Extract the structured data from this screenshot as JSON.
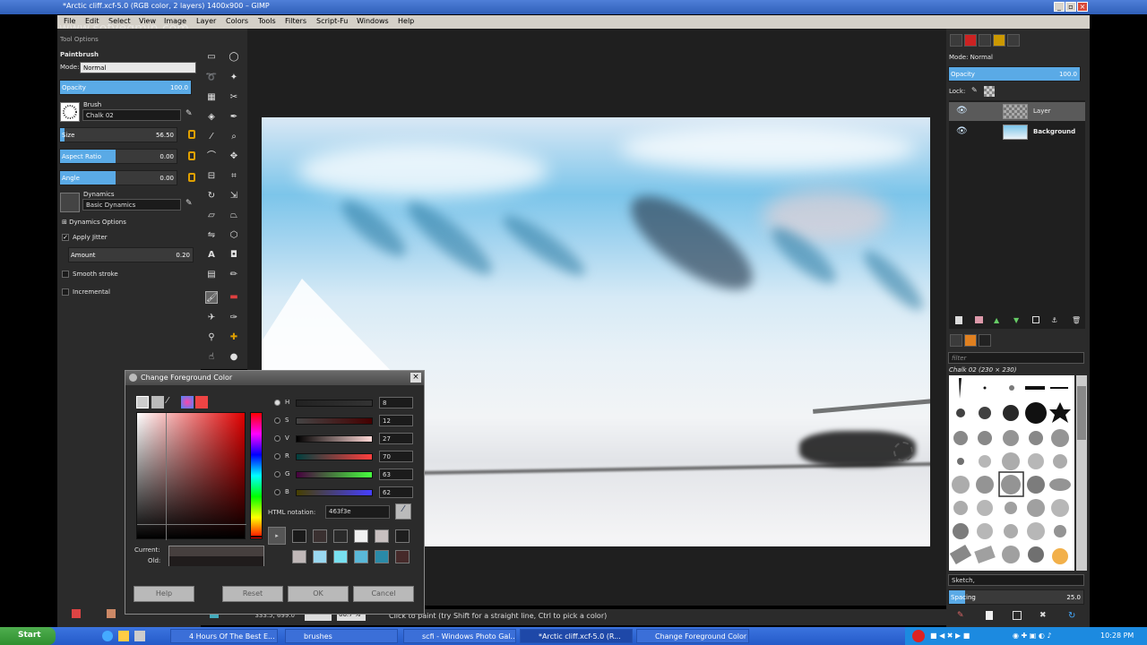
{
  "window": {
    "title": "*Arctic cliff.xcf-5.0 (RGB color, 2 layers) 1400x900 – GIMP"
  },
  "watermark": "www.sofvegmin.com",
  "menu": [
    "File",
    "Edit",
    "Select",
    "View",
    "Image",
    "Layer",
    "Colors",
    "Tools",
    "Filters",
    "Script-Fu",
    "Windows",
    "Help"
  ],
  "tool_options": {
    "tab": "Tool Options",
    "tool_name": "Paintbrush",
    "mode_label": "Mode:",
    "mode_value": "Normal",
    "opacity": {
      "label": "Opacity",
      "value": "100.0",
      "fraction": 1.0
    },
    "brush_label": "Brush",
    "brush_value": "Chalk 02",
    "size": {
      "label": "Size",
      "value": "56.50",
      "fraction": 0.0
    },
    "aspect": {
      "label": "Aspect Ratio",
      "value": "0.00",
      "fraction": 0.5
    },
    "angle": {
      "label": "Angle",
      "value": "0.00",
      "fraction": 0.5
    },
    "dynamics_label": "Dynamics",
    "dynamics_value": "Basic Dynamics",
    "dynamics_options": "Dynamics Options",
    "apply_jitter": "Apply Jitter",
    "amount": {
      "label": "Amount",
      "value": "0.20"
    },
    "smooth_stroke": "Smooth stroke",
    "incremental": "Incremental"
  },
  "layers": {
    "mode_label": "Mode:",
    "mode_value": "Normal",
    "opacity_label": "Opacity",
    "opacity_value": "100.0",
    "lock_label": "Lock:",
    "items": [
      {
        "name": "Layer"
      },
      {
        "name": "Background"
      }
    ]
  },
  "brushes": {
    "filter": "filter",
    "current": "Chalk 02 (230 × 230)",
    "tag": "Sketch,",
    "spacing_label": "Spacing",
    "spacing_value": "25.0"
  },
  "status": {
    "coords": "1333.5, 699.0",
    "zoom": "66.7 %",
    "message": "Click to paint (try Shift for a straight line, Ctrl to pick a color)"
  },
  "dialog": {
    "title": "Change Foreground Color",
    "channels": [
      {
        "label": "H",
        "value": "8"
      },
      {
        "label": "S",
        "value": "12"
      },
      {
        "label": "V",
        "value": "27"
      },
      {
        "label": "R",
        "value": "70"
      },
      {
        "label": "G",
        "value": "63"
      },
      {
        "label": "B",
        "value": "62"
      }
    ],
    "html_label": "HTML notation:",
    "html_value": "463f3e",
    "current_label": "Current:",
    "old_label": "Old:",
    "buttons": {
      "help": "Help",
      "reset": "Reset",
      "ok": "OK",
      "cancel": "Cancel"
    },
    "history_colors": [
      "#1a1a1a",
      "#3a3030",
      "#2a2a2a",
      "#f0f0f0",
      "#c8c0c0",
      "#1e1e1e",
      "#c0b8b8",
      "#9ad8f0",
      "#78e0f0",
      "#5ab8d8",
      "#2a8aa8",
      "#462a2a"
    ]
  },
  "taskbar": {
    "start": "Start",
    "tasks": [
      "4 Hours Of The Best E...",
      "brushes",
      "scfi - Windows Photo Gal...",
      "*Arctic cliff.xcf-5.0 (R...",
      "Change Foreground Color"
    ],
    "clock": "10:28 PM"
  }
}
